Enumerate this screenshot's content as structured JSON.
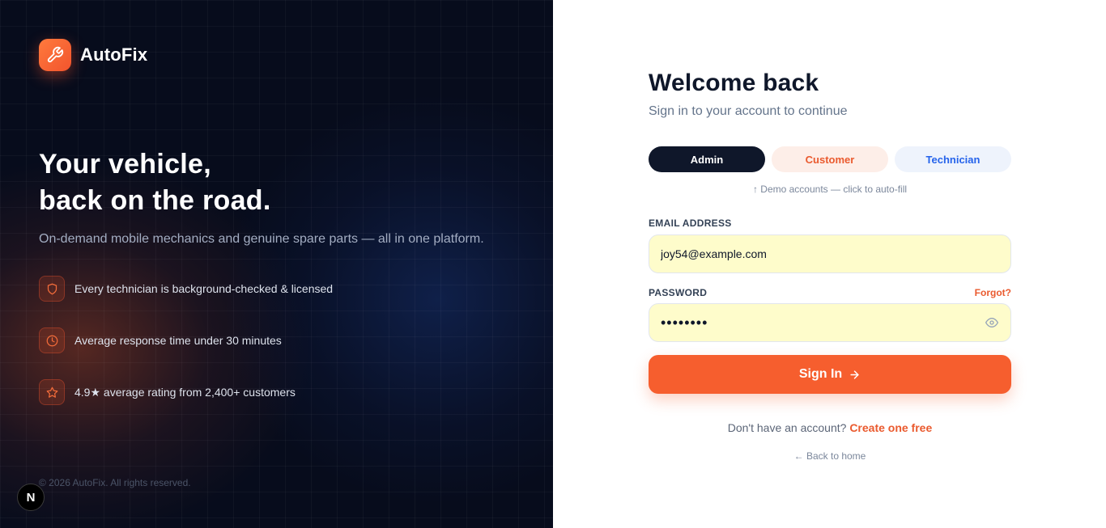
{
  "brand": {
    "name": "AutoFix",
    "icon": "wrench-icon"
  },
  "hero": {
    "line1": "Your vehicle,",
    "line2": "back on the road.",
    "tagline": "On-demand mobile mechanics and genuine spare parts — all in one platform."
  },
  "features": [
    {
      "icon": "shield-icon",
      "text": "Every technician is background-checked & licensed"
    },
    {
      "icon": "clock-icon",
      "text": "Average response time under 30 minutes"
    },
    {
      "icon": "star-icon",
      "text": "4.9★ average rating from 2,400+ customers"
    }
  ],
  "footer": {
    "copyright": "© 2026 AutoFix. All rights reserved.",
    "badge": "N"
  },
  "form": {
    "title": "Welcome back",
    "subtitle": "Sign in to your account to continue",
    "roles": [
      "Admin",
      "Customer",
      "Technician"
    ],
    "demo_hint": "↑ Demo accounts — click to auto-fill",
    "email_label": "EMAIL ADDRESS",
    "email_value": "joy54@example.com",
    "password_label": "PASSWORD",
    "forgot": "Forgot?",
    "password_value": "••••••••",
    "signin": "Sign In",
    "signup_prompt": "Don't have an account?",
    "signup_link": "Create one free",
    "back": "← Back to home"
  },
  "colors": {
    "accent": "#f65e2e",
    "navy": "#0f172a",
    "input_bg": "#fefccb",
    "technician": "#2563eb"
  }
}
